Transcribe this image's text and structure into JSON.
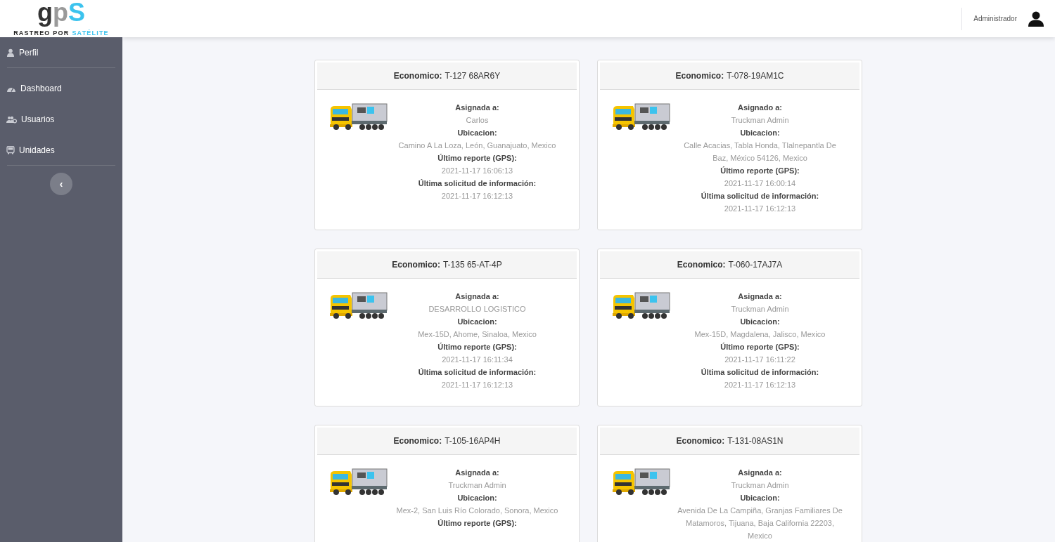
{
  "logo": {
    "letters": [
      {
        "text": "g",
        "color": "#333333"
      },
      {
        "text": "p",
        "color": "#9a9a9a"
      },
      {
        "text": "S",
        "color": "#3cc3ee"
      }
    ],
    "tagline": [
      {
        "text": "RASTREO POR",
        "color": "#222222"
      },
      {
        "text": "SATÉLITE",
        "color": "#3cc3ee"
      }
    ]
  },
  "header": {
    "user": "Administrador"
  },
  "sidebar": {
    "items": [
      {
        "label": "Perfil",
        "divider_after": true
      },
      {
        "label": "Dashboard",
        "divider_after": false
      },
      {
        "label": "Usuarios",
        "divider_after": false
      },
      {
        "label": "Unidades",
        "divider_after": true
      }
    ],
    "toggle": "‹"
  },
  "cards": [
    {
      "title_label": "Economico:",
      "title_value": "T-127 68AR6Y",
      "fields": [
        {
          "label": "Asignada a:",
          "value": "Carlos"
        },
        {
          "label": "Ubicacion:",
          "value": "Camino A La Loza, León, Guanajuato, Mexico"
        },
        {
          "label": "Último reporte (GPS):",
          "value": "2021-11-17 16:06:13"
        },
        {
          "label": "Última solicitud de información:",
          "value": "2021-11-17 16:12:13"
        }
      ]
    },
    {
      "title_label": "Economico:",
      "title_value": "T-078-19AM1C",
      "fields": [
        {
          "label": "Asignado a:",
          "value": "Truckman Admin"
        },
        {
          "label": "Ubicacion:",
          "value": "Calle Acacias, Tabla Honda, Tlalnepantla De Baz, México 54126, Mexico"
        },
        {
          "label": "Último reporte (GPS):",
          "value": "2021-11-17 16:00:14"
        },
        {
          "label": "Última solicitud de información:",
          "value": "2021-11-17 16:12:13"
        }
      ]
    },
    {
      "title_label": "Economico:",
      "title_value": "T-135 65-AT-4P",
      "fields": [
        {
          "label": "Asignada a:",
          "value": "DESARROLLO LOGISTICO"
        },
        {
          "label": "Ubicacion:",
          "value": "Mex-15D, Ahome, Sinaloa, Mexico"
        },
        {
          "label": "Último reporte (GPS):",
          "value": "2021-11-17 16:11:34"
        },
        {
          "label": "Última solicitud de información:",
          "value": "2021-11-17 16:12:13"
        }
      ]
    },
    {
      "title_label": "Economico:",
      "title_value": "T-060-17AJ7A",
      "fields": [
        {
          "label": "Asignada a:",
          "value": "Truckman Admin"
        },
        {
          "label": "Ubicacion:",
          "value": "Mex-15D, Magdalena, Jalisco, Mexico"
        },
        {
          "label": "Último reporte (GPS):",
          "value": "2021-11-17 16:11:22"
        },
        {
          "label": "Última solicitud de información:",
          "value": "2021-11-17 16:12:13"
        }
      ]
    },
    {
      "title_label": "Economico:",
      "title_value": "T-105-16AP4H",
      "fields": [
        {
          "label": "Asignada a:",
          "value": "Truckman Admin"
        },
        {
          "label": "Ubicacion:",
          "value": "Mex-2, San Luis Río Colorado, Sonora, Mexico"
        },
        {
          "label": "Último reporte (GPS):"
        }
      ]
    },
    {
      "title_label": "Economico:",
      "title_value": "T-131-08AS1N",
      "fields": [
        {
          "label": "Asignada a:",
          "value": "Truckman Admin"
        },
        {
          "label": "Ubicacion:",
          "value": "Avenida De La Campiña, Granjas Familiares De Matamoros, Tijuana, Baja California 22203, Mexico"
        }
      ]
    }
  ]
}
